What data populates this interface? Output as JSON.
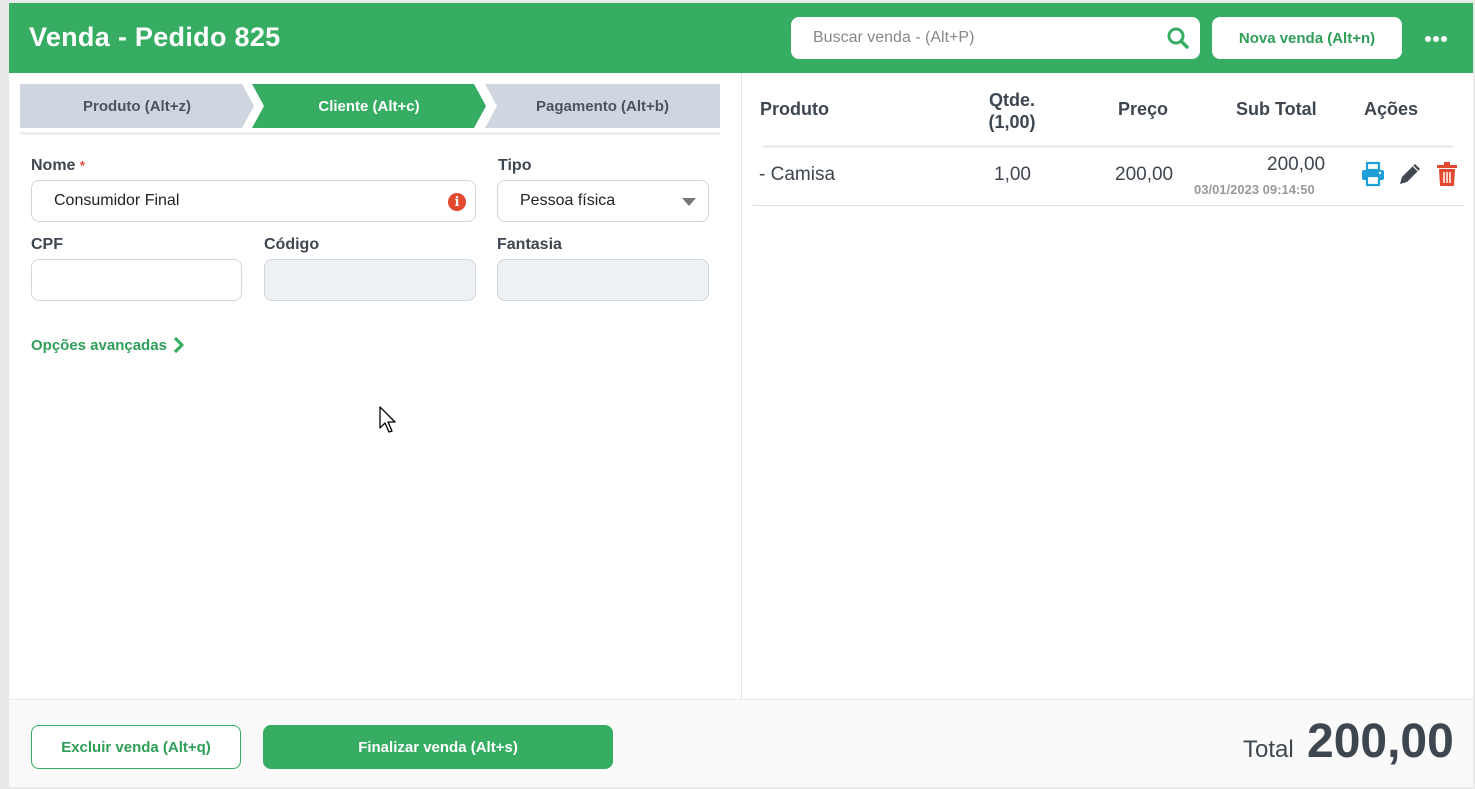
{
  "header": {
    "title": "Venda - Pedido 825",
    "search_placeholder": "Buscar venda - (Alt+P)",
    "new_sale_label": "Nova venda  (Alt+n)"
  },
  "steps": [
    {
      "label": "Produto (Alt+z)",
      "active": false
    },
    {
      "label": "Cliente (Alt+c)",
      "active": true
    },
    {
      "label": "Pagamento (Alt+b)",
      "active": false
    }
  ],
  "form": {
    "nome_label": "Nome",
    "required_mark": "*",
    "nome_value": "Consumidor Final",
    "tipo_label": "Tipo",
    "tipo_value": "Pessoa física",
    "cpf_label": "CPF",
    "cpf_value": "",
    "codigo_label": "Código",
    "codigo_value": "",
    "fantasia_label": "Fantasia",
    "fantasia_value": "",
    "advanced_label": "Opções avançadas"
  },
  "table": {
    "headers": {
      "produto": "Produto",
      "qtde_line1": "Qtde.",
      "qtde_line2": "(1,00)",
      "preco": "Preço",
      "subtotal": "Sub Total",
      "acoes": "Ações"
    },
    "rows": [
      {
        "produto": "- Camisa",
        "qtde": "1,00",
        "preco": "200,00",
        "subtotal": "200,00",
        "datetime": "03/01/2023 09:14:50"
      }
    ]
  },
  "footer": {
    "delete_label": "Excluir venda (Alt+q)",
    "finish_label": "Finalizar venda (Alt+s)",
    "total_label": "Total",
    "total_value": "200,00"
  },
  "colors": {
    "brand_green": "#37ad63",
    "print_blue": "#1f9fd8",
    "edit_gray": "#3e4650",
    "delete_red": "#e2492f"
  },
  "icons": [
    "search-icon",
    "more-icon",
    "info-icon",
    "chevron-right-icon",
    "printer-icon",
    "pencil-icon",
    "trash-icon",
    "cursor-icon"
  ]
}
